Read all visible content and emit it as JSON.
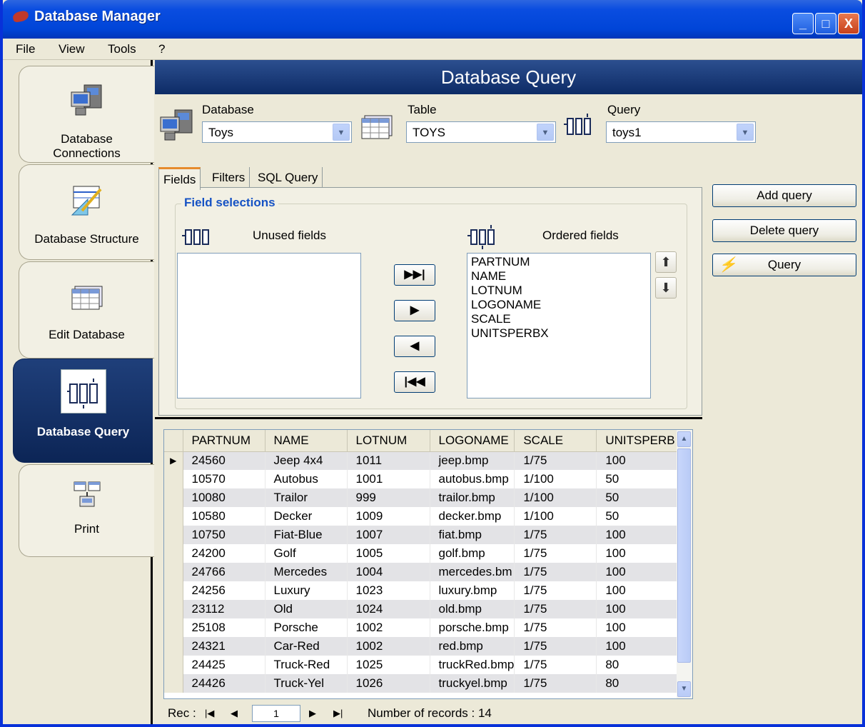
{
  "window": {
    "title": "Database Manager",
    "minimize": "_",
    "maximize": "□",
    "close": "X"
  },
  "menu": [
    "File",
    "View",
    "Tools",
    "?"
  ],
  "sidebar": {
    "items": [
      {
        "label_l1": "Database",
        "label_l2": "Connections"
      },
      {
        "label_l1": "Database Structure"
      },
      {
        "label_l1": "Edit Database"
      },
      {
        "label_l1": "Database Query",
        "active": true
      },
      {
        "label_l1": "Print"
      }
    ]
  },
  "header": {
    "title": "Database Query"
  },
  "selectors": {
    "database": {
      "label": "Database",
      "value": "Toys"
    },
    "table": {
      "label": "Table",
      "value": "TOYS"
    },
    "query": {
      "label": "Query",
      "value": "toys1"
    }
  },
  "tabs": [
    "Fields",
    "Filters",
    "SQL Query"
  ],
  "field_selections": {
    "title": "Field selections",
    "unused_label": "Unused fields",
    "ordered_label": "Ordered fields",
    "unused": [],
    "ordered": [
      "PARTNUM",
      "NAME",
      "LOTNUM",
      "LOGONAME",
      "SCALE",
      "UNITSPERBX"
    ]
  },
  "actions": {
    "add": "Add query",
    "delete": "Delete query",
    "query": "Query"
  },
  "grid": {
    "columns": [
      "PARTNUM",
      "NAME",
      "LOTNUM",
      "LOGONAME",
      "SCALE",
      "UNITSPERB"
    ],
    "rows": [
      [
        "24560",
        "Jeep 4x4",
        "1011",
        "jeep.bmp",
        "1/75",
        "100"
      ],
      [
        "10570",
        "Autobus",
        "1001",
        "autobus.bmp",
        "1/100",
        "50"
      ],
      [
        "10080",
        "Trailor",
        "999",
        "trailor.bmp",
        "1/100",
        "50"
      ],
      [
        "10580",
        "Decker",
        "1009",
        "decker.bmp",
        "1/100",
        "50"
      ],
      [
        "10750",
        "Fiat-Blue",
        "1007",
        "fiat.bmp",
        "1/75",
        "100"
      ],
      [
        "24200",
        "Golf",
        "1005",
        "golf.bmp",
        "1/75",
        "100"
      ],
      [
        "24766",
        "Mercedes",
        "1004",
        "mercedes.bm",
        "1/75",
        "100"
      ],
      [
        "24256",
        "Luxury",
        "1023",
        "luxury.bmp",
        "1/75",
        "100"
      ],
      [
        "23112",
        "Old",
        "1024",
        "old.bmp",
        "1/75",
        "100"
      ],
      [
        "25108",
        "Porsche",
        "1002",
        "porsche.bmp",
        "1/75",
        "100"
      ],
      [
        "24321",
        "Car-Red",
        "1002",
        "red.bmp",
        "1/75",
        "100"
      ],
      [
        "24425",
        "Truck-Red",
        "1025",
        "truckRed.bmp",
        "1/75",
        "80"
      ],
      [
        "24426",
        "Truck-Yel",
        "1026",
        "truckyel.bmp",
        "1/75",
        "80"
      ]
    ],
    "current_row_marker": "▶"
  },
  "navigator": {
    "rec_label": "Rec :",
    "current": "1",
    "count_text": "Number of records : 14"
  },
  "colors": {
    "title_blue": "#0a4de0",
    "header_navy": "#0d2b66",
    "accent_blue": "#1652c4"
  }
}
